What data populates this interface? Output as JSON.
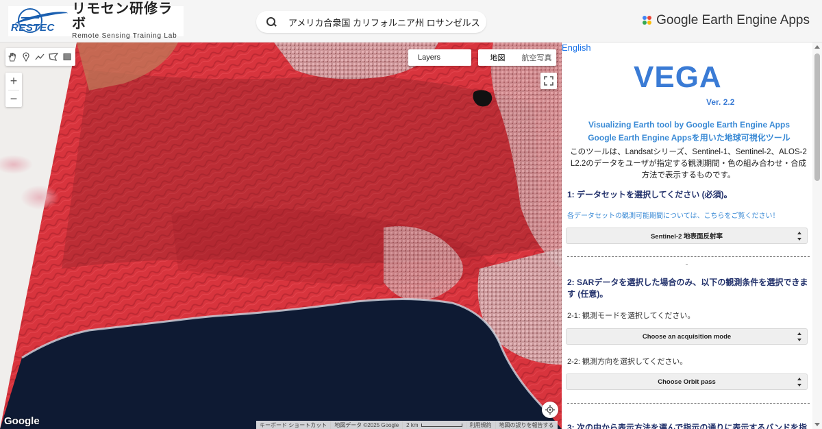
{
  "header": {
    "logo_brand": "RESTEC",
    "logo_title": "リモセン研修ラボ",
    "logo_subtitle": "Remote Sensing Training Lab",
    "search_text": "アメリカ合衆国 カリフォルニア州 ロサンゼルス",
    "app_brand": "Google Earth Engine Apps"
  },
  "map": {
    "layers_label": "Layers",
    "map_types": [
      "地図",
      "航空写真"
    ],
    "zoom_in": "+",
    "zoom_out": "−",
    "google_logo": "Google",
    "attribution": {
      "shortcuts": "キーボード ショートカット",
      "data": "地図データ ©2025 Google",
      "scale": "2 km",
      "terms": "利用規約",
      "report": "地図の誤りを報告する"
    }
  },
  "panel": {
    "language_link": "English",
    "title": "VEGA",
    "version": "Ver. 2.2",
    "subtitle_en": "Visualizing Earth tool by Google Earth Engine Apps",
    "subtitle_jp": "Google Earth Engine Appsを用いた地球可視化ツール",
    "intro": "このツールは、Landsatシリーズ、Sentinel-1、Sentinel-2、ALOS-2 L2.2のデータをユーザが指定する観測期間・色の組み合わせ・合成方法で表示するものです。",
    "step1_heading": "1: データセットを選択してください (必須)。",
    "step1_link": "各データセットの観測可能期間については、こちらをご覧ください！",
    "dataset_select": "Sentinel-2 地表面反射率",
    "step2_heading": "2: SARデータを選択した場合のみ、以下の観測条件を選択できます (任意)。",
    "step2_1_label": "2-1: 観測モードを選択してください。",
    "acquisition_select": "Choose an acquisition mode",
    "step2_2_label": "2-2: 観測方向を選択してください。",
    "orbit_select": "Choose Orbit pass",
    "step3_heading": "3: 次の中から表示方法を選んで指示の通りに表示するバンドを指"
  }
}
